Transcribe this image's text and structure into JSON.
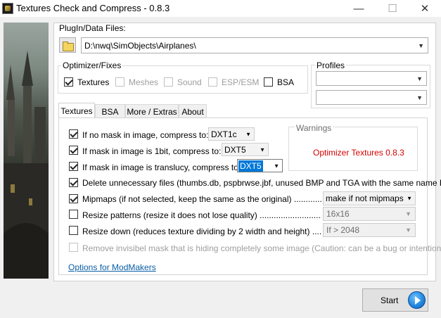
{
  "window": {
    "title": "Textures Check and Compress - 0.8.3",
    "minimize_glyph": "—",
    "maximize_glyph": "☐",
    "close_glyph": "✕"
  },
  "plugin": {
    "label": "PlugIn/Data Files:",
    "path": "D:\\nwq\\SimObjects\\Airplanes\\"
  },
  "optimizer": {
    "label": "Optimizer/Fixes",
    "options": [
      {
        "label": "Textures",
        "checked": true,
        "enabled": true
      },
      {
        "label": "Meshes",
        "checked": false,
        "enabled": false
      },
      {
        "label": "Sound",
        "checked": false,
        "enabled": false
      },
      {
        "label": "ESP/ESM",
        "checked": false,
        "enabled": false
      },
      {
        "label": "BSA",
        "checked": false,
        "enabled": true
      }
    ]
  },
  "profiles": {
    "label": "Profiles",
    "combo1": "",
    "combo2": ""
  },
  "tabs": [
    "Textures",
    "BSA",
    "More / Extras",
    "About"
  ],
  "active_tab": "Textures",
  "textures": {
    "no_mask": {
      "label": "If no mask in image, compress to:",
      "value": "DXT1c",
      "checked": true
    },
    "mask_1bit": {
      "label": "If mask in image is 1bit, compress to:",
      "value": "DXT5",
      "checked": true
    },
    "mask_translucy": {
      "label": "If mask in image is translucy, compress to:",
      "value": "DXT5",
      "checked": true
    },
    "delete_files": {
      "label": "Delete unnecessary files (thumbs.db, pspbrwse.jbf, unused BMP and TGA with the same name DDS).",
      "checked": true
    },
    "mipmaps": {
      "label": "Mipmaps (if not selected, keep the same as the original) ..........................",
      "value": "make if not mipmaps",
      "checked": true
    },
    "resize_patterns": {
      "label": "Resize patterns (resize it does not lose quality) ...........................................",
      "value": "16x16",
      "checked": false
    },
    "resize_down": {
      "label": "Resize down (reduces texture dividing by 2 width and height) ...................",
      "value": "If > 2048",
      "checked": false
    },
    "remove_mask": {
      "label": "Remove invisibel mask that is hiding completely some image (Caution: can be a bug or intentional)",
      "checked": false
    },
    "modmakers_link": "Options for ModMakers"
  },
  "warnings": {
    "label": "Warnings",
    "message": "Optimizer Textures 0.8.3",
    "message_color": "#d40000"
  },
  "start_button": "Start"
}
